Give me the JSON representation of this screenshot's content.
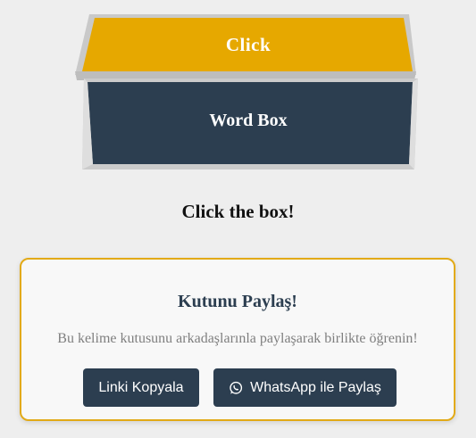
{
  "box": {
    "lid_label": "Click",
    "word_label": "Word Box",
    "colors": {
      "lid": "#e6a800",
      "front": "#2c3e50",
      "frame": "#c8c8c8"
    }
  },
  "prompt": {
    "text": "Click the box!"
  },
  "share": {
    "title": "Kutunu Paylaş!",
    "description": "Bu kelime kutusunu arkadaşlarınla paylaşarak birlikte öğrenin!",
    "copy_button_label": "Linki Kopyala",
    "whatsapp_button_label": "WhatsApp ile Paylaş",
    "whatsapp_icon": "whatsapp-icon",
    "colors": {
      "border": "#e2aa17",
      "button": "#2c3e50"
    }
  }
}
